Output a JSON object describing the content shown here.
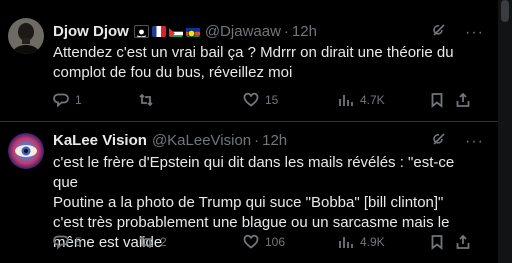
{
  "posts": [
    {
      "name": "Djow Djow",
      "handle": "@Djawaaw",
      "separator": "·",
      "time": "12h",
      "text": "Attendez c'est un vrai bail ça ? Mdrrr on dirait une théorie du\ncomplot de fou du bus, réveillez moi",
      "flags": [
        "skull-crossbones-icon",
        "france-flag",
        "palestine-flag",
        "new-caledonia-flag"
      ],
      "replies": "1",
      "reposts": "",
      "likes": "15",
      "views": "4.7K"
    },
    {
      "name": "KaLee Vision",
      "handle": "@KaLeeVision",
      "separator": "·",
      "time": "12h",
      "text": "c'est le frère d'Epstein qui dit dans les mails révélés : \"est-ce que\nPoutine a la photo de Trump qui suce \"Bobba\" [bill clinton]\"\nc'est très probablement une blague ou un sarcasme mais le\nmême est valide",
      "replies": "5",
      "reposts": "2",
      "likes": "106",
      "views": "4.9K"
    }
  ],
  "more_label": "···",
  "colors": {
    "background": "#000000",
    "text": "#e7e9ea",
    "muted": "#71767b",
    "divider": "#2f3336"
  }
}
